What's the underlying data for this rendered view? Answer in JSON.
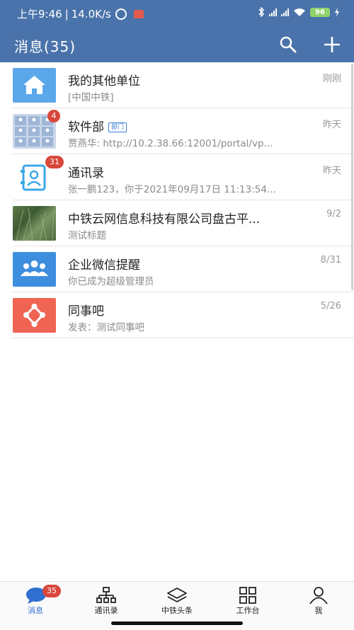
{
  "status": {
    "time": "上午9:46",
    "speed": "14.0K/s",
    "battery": "96"
  },
  "appbar": {
    "title": "消息(35)"
  },
  "conversations": [
    {
      "name": "我的其他单位",
      "sub": "[中国中铁]",
      "time": "刚刚",
      "icon": "house-icon"
    },
    {
      "name": "软件部",
      "tag": "部门",
      "sub": "贾燕华: http://10.2.38.66:12001/portal/vp...",
      "time": "昨天",
      "badge": "4",
      "icon": "group-grid-icon"
    },
    {
      "name": "通讯录",
      "sub": "张一鹏123，你于2021年09月17日 11:13:54...",
      "time": "昨天",
      "badge": "31",
      "icon": "contacts-book-icon"
    },
    {
      "name": "中铁云网信息科技有限公司盘古平...",
      "sub": "测试标题",
      "time": "9/2",
      "icon": "grass-photo"
    },
    {
      "name": "企业微信提醒",
      "sub": "你已成为超级管理员",
      "time": "8/31",
      "icon": "people-icon"
    },
    {
      "name": "同事吧",
      "sub": "发表：测试同事吧",
      "time": "5/26",
      "icon": "share-nodes-icon"
    }
  ],
  "tabs": [
    {
      "label": "消息",
      "badge": "35",
      "active": true
    },
    {
      "label": "通讯录"
    },
    {
      "label": "中铁头条"
    },
    {
      "label": "工作台"
    },
    {
      "label": "我"
    }
  ],
  "colors": {
    "header": "#4a73ab",
    "accent": "#2f6fd0",
    "badge": "#d9473b"
  }
}
